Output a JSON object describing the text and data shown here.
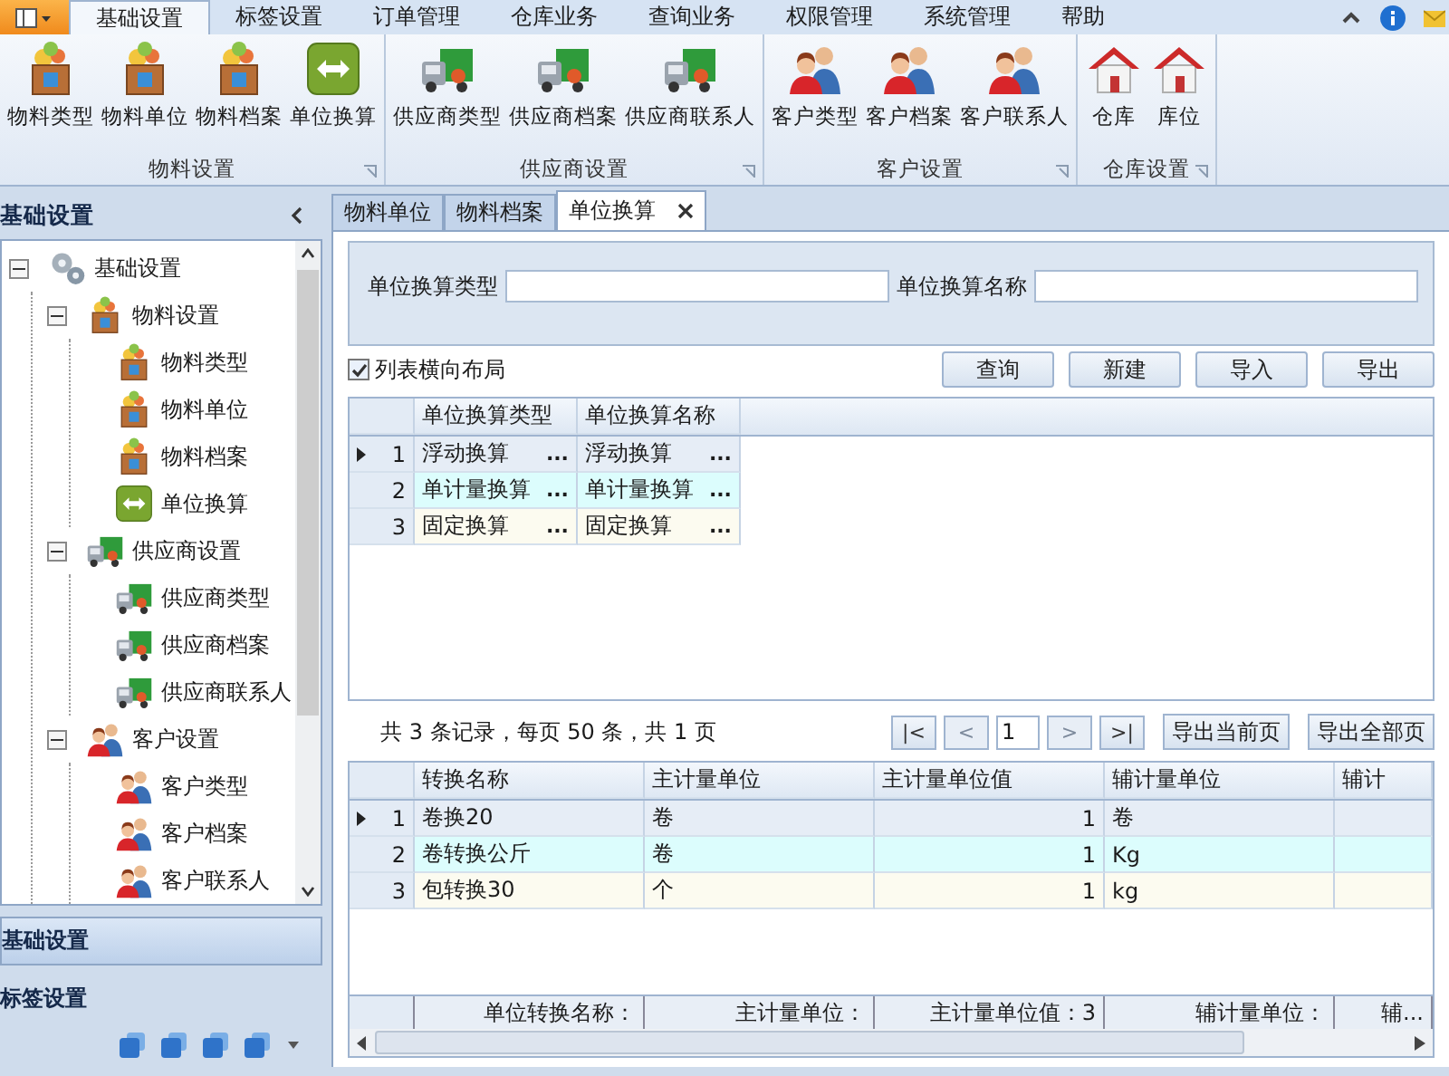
{
  "ribbon_tabs": [
    {
      "label": "基础设置",
      "selected": true
    },
    {
      "label": "标签设置",
      "selected": false
    },
    {
      "label": "订单管理",
      "selected": false
    },
    {
      "label": "仓库业务",
      "selected": false
    },
    {
      "label": "查询业务",
      "selected": false
    },
    {
      "label": "权限管理",
      "selected": false
    },
    {
      "label": "系统管理",
      "selected": false
    },
    {
      "label": "帮助",
      "selected": false
    }
  ],
  "ribbon_groups": [
    {
      "label": "物料设置",
      "buttons": [
        {
          "label": "物料类型",
          "kind": "box"
        },
        {
          "label": "物料单位",
          "kind": "box"
        },
        {
          "label": "物料档案",
          "kind": "box"
        },
        {
          "label": "单位换算",
          "kind": "convert"
        }
      ]
    },
    {
      "label": "供应商设置",
      "buttons": [
        {
          "label": "供应商类型",
          "kind": "truck"
        },
        {
          "label": "供应商档案",
          "kind": "truck"
        },
        {
          "label": "供应商联系人",
          "kind": "truck"
        }
      ]
    },
    {
      "label": "客户设置",
      "buttons": [
        {
          "label": "客户类型",
          "kind": "person"
        },
        {
          "label": "客户档案",
          "kind": "person"
        },
        {
          "label": "客户联系人",
          "kind": "person"
        }
      ]
    },
    {
      "label": "仓库设置",
      "buttons": [
        {
          "label": "仓库",
          "kind": "house"
        },
        {
          "label": "库位",
          "kind": "house"
        }
      ]
    }
  ],
  "sidebar": {
    "title": "基础设置",
    "tree": [
      {
        "label": "基础设置",
        "kind": "gear",
        "expanded": true,
        "children": [
          {
            "label": "物料设置",
            "kind": "box",
            "expanded": true,
            "children": [
              {
                "label": "物料类型",
                "kind": "box"
              },
              {
                "label": "物料单位",
                "kind": "box"
              },
              {
                "label": "物料档案",
                "kind": "box"
              },
              {
                "label": "单位换算",
                "kind": "convert"
              }
            ]
          },
          {
            "label": "供应商设置",
            "kind": "truck",
            "expanded": true,
            "children": [
              {
                "label": "供应商类型",
                "kind": "truck"
              },
              {
                "label": "供应商档案",
                "kind": "truck"
              },
              {
                "label": "供应商联系人",
                "kind": "truck"
              }
            ]
          },
          {
            "label": "客户设置",
            "kind": "person",
            "expanded": true,
            "children": [
              {
                "label": "客户类型",
                "kind": "person"
              },
              {
                "label": "客户档案",
                "kind": "person"
              },
              {
                "label": "客户联系人",
                "kind": "person"
              }
            ]
          }
        ]
      }
    ],
    "nav": [
      {
        "label": "基础设置",
        "selected": true
      },
      {
        "label": "标签设置",
        "selected": false
      }
    ]
  },
  "doc_tabs": [
    {
      "label": "物料单位",
      "selected": false,
      "closable": false
    },
    {
      "label": "物料档案",
      "selected": false,
      "closable": false
    },
    {
      "label": "单位换算",
      "selected": true,
      "closable": true
    }
  ],
  "filter_fields": [
    {
      "label": "单位换算类型"
    },
    {
      "label": "单位换算名称"
    }
  ],
  "layout_option": {
    "label": "列表横向布局",
    "checked": true
  },
  "actions": [
    "查询",
    "新建",
    "导入",
    "导出"
  ],
  "grid": {
    "columns": [
      "单位换算类型",
      "单位换算名称"
    ],
    "rows": [
      {
        "index": "1",
        "selected": true,
        "cells": [
          {
            "text": "浮动换算",
            "button": "..."
          },
          {
            "text": "浮动换算",
            "button": "..."
          }
        ]
      },
      {
        "index": "2",
        "selected": false,
        "cells": [
          {
            "text": "单计量换算",
            "button": "..."
          },
          {
            "text": "单计量换算",
            "button": "..."
          }
        ]
      },
      {
        "index": "3",
        "selected": false,
        "cells": [
          {
            "text": "固定换算",
            "button": "..."
          },
          {
            "text": "固定换算",
            "button": "..."
          }
        ]
      }
    ]
  },
  "pager": {
    "summary": "共 3 条记录，每页 50 条，共 1 页",
    "first": [
      {
        "label": "|<",
        "disabled": false
      },
      {
        "label": "<",
        "disabled": true
      }
    ],
    "page": "1",
    "last": [
      {
        "label": ">",
        "disabled": true
      },
      {
        "label": ">|",
        "disabled": false
      }
    ],
    "exports": [
      "导出当前页",
      "导出全部页"
    ]
  },
  "detail_grid": {
    "columns": [
      "转换名称",
      "主计量单位",
      "主计量单位值",
      "辅计量单位",
      "辅计"
    ],
    "rows": [
      {
        "index": "1",
        "selected": true,
        "cells": [
          {
            "text": "卷换20",
            "kind": "text"
          },
          {
            "text": "卷",
            "kind": "text"
          },
          {
            "text": "1",
            "kind": "number"
          },
          {
            "text": "卷",
            "kind": "text"
          }
        ]
      },
      {
        "index": "2",
        "selected": false,
        "cells": [
          {
            "text": "卷转换公斤",
            "kind": "text"
          },
          {
            "text": "卷",
            "kind": "text"
          },
          {
            "text": "1",
            "kind": "number"
          },
          {
            "text": "Kg",
            "kind": "text"
          }
        ]
      },
      {
        "index": "3",
        "selected": false,
        "cells": [
          {
            "text": "包转换30",
            "kind": "text"
          },
          {
            "text": "个",
            "kind": "text"
          },
          {
            "text": "1",
            "kind": "number"
          },
          {
            "text": "kg",
            "kind": "text"
          }
        ]
      }
    ],
    "footer": [
      "单位转换名称：",
      "主计量单位：",
      "主计量单位值：3",
      "辅计量单位：",
      "辅..."
    ]
  }
}
